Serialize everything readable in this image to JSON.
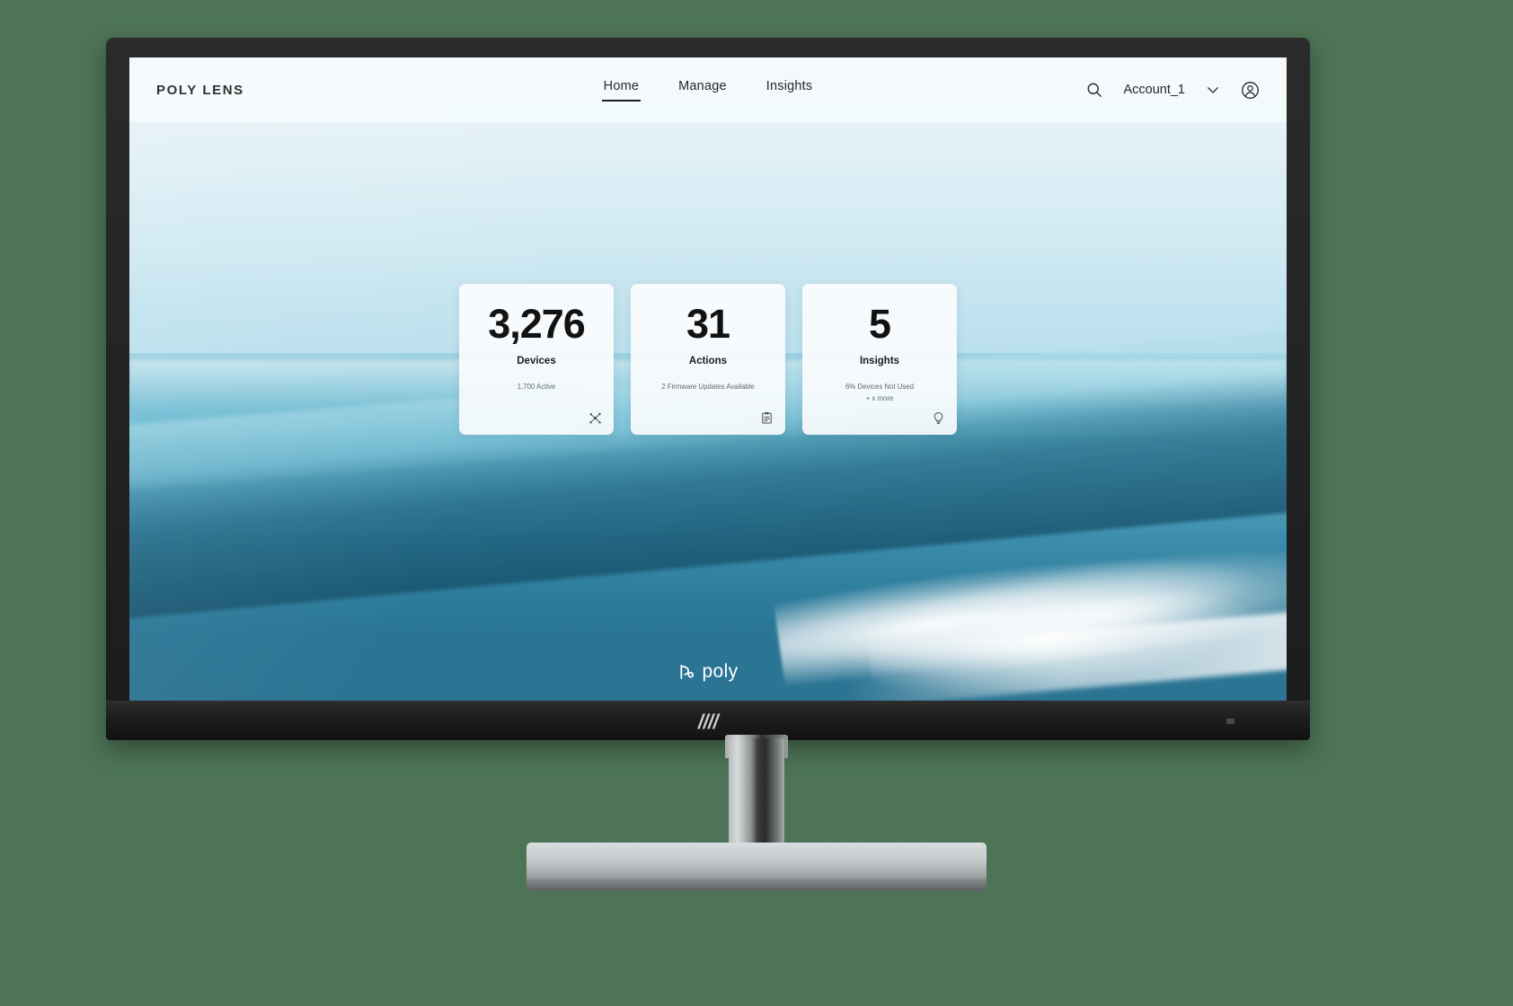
{
  "app": {
    "brand": "POLY LENS",
    "watermark": "poly"
  },
  "nav": {
    "items": [
      {
        "label": "Home",
        "active": true
      },
      {
        "label": "Manage",
        "active": false
      },
      {
        "label": "Insights",
        "active": false
      }
    ]
  },
  "topbar_right": {
    "search_icon": "search-icon",
    "account_name": "Account_1",
    "chevron_icon": "chevron-down-icon",
    "avatar_icon": "account-avatar-icon"
  },
  "cards": [
    {
      "value": "3,276",
      "title": "Devices",
      "sub1": "1,700 Active",
      "sub2": "",
      "icon": "devices-network-icon"
    },
    {
      "value": "31",
      "title": "Actions",
      "sub1": "2 Firmware Updates Available",
      "sub2": "",
      "icon": "clipboard-icon"
    },
    {
      "value": "5",
      "title": "Insights",
      "sub1": "6% Devices Not Used",
      "sub2": "+ x more",
      "icon": "lightbulb-icon"
    }
  ],
  "hardware": {
    "vendor_logo": "hp-logo",
    "power_led": "power-indicator-led"
  },
  "colors": {
    "page_background": "#4d7456",
    "topbar_background": "#f4fafc",
    "card_background": "#fcfdfe",
    "text_primary": "#1b1b1b",
    "text_muted": "#5f6a70",
    "sea_deep": "#2b7493",
    "sea_mid": "#4f9fbb",
    "sky": "#eef6fa"
  }
}
